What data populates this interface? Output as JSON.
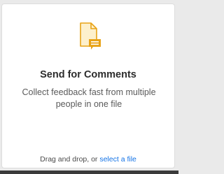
{
  "card": {
    "title": "Send for Comments",
    "description": "Collect feedback fast from multiple people in one file",
    "drop_prefix": "Drag and drop, or ",
    "select_link": "select a file",
    "icon": "document-comment-icon"
  },
  "colors": {
    "accent": "#1473e6",
    "icon_outline": "#e8a317",
    "icon_fill": "#fdf0cc"
  }
}
